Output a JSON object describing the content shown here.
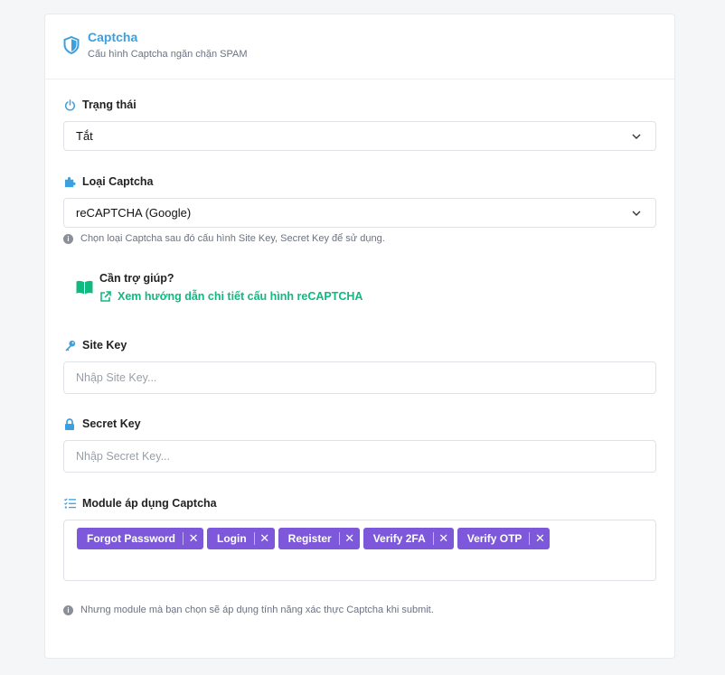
{
  "header": {
    "title": "Captcha",
    "subtitle": "Cấu hình Captcha ngăn chặn SPAM",
    "icon": "shield-icon",
    "accent": "#3aa0e0"
  },
  "status": {
    "label": "Trạng thái",
    "icon": "power-icon",
    "value": "Tắt"
  },
  "captcha_type": {
    "label": "Loại Captcha",
    "icon": "puzzle-icon",
    "value": "reCAPTCHA (Google)",
    "hint": "Chọn loại Captcha sau đó cấu hình Site Key, Secret Key để sử dụng."
  },
  "help": {
    "title": "Cần trợ giúp?",
    "link": "Xem hướng dẫn chi tiết cấu hình reCAPTCHA",
    "link_color": "#10b981"
  },
  "site_key": {
    "label": "Site Key",
    "icon": "key-icon",
    "placeholder": "Nhập Site Key..."
  },
  "secret_key": {
    "label": "Secret Key",
    "icon": "lock-icon",
    "placeholder": "Nhập Secret Key..."
  },
  "modules": {
    "label": "Module áp dụng Captcha",
    "icon": "list-check-icon",
    "tag_color": "#7d58db",
    "tags": [
      "Forgot Password",
      "Login",
      "Register",
      "Verify 2FA",
      "Verify OTP"
    ],
    "hint": "Nhưng module mà bạn chọn sẽ áp dụng tính năng xác thực Captcha khi submit."
  }
}
